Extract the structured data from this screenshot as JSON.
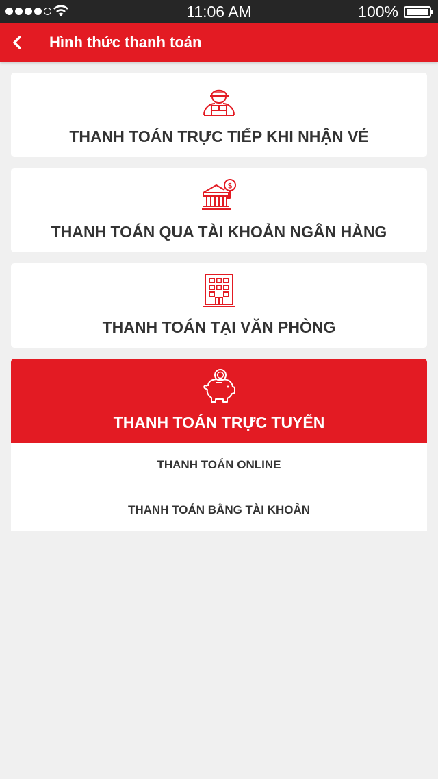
{
  "status_bar": {
    "time": "11:06 AM",
    "battery": "100%"
  },
  "header": {
    "title": "Hình thức thanh toán"
  },
  "colors": {
    "accent": "#e31b23",
    "background": "#f0f0f0",
    "card": "#ffffff",
    "text": "#333333"
  },
  "payment_options": [
    {
      "label": "THANH TOÁN TRỰC TIẾP KHI NHẬN VÉ",
      "icon": "delivery-person-icon",
      "selected": false
    },
    {
      "label": "THANH TOÁN QUA TÀI KHOẢN NGÂN HÀNG",
      "icon": "bank-icon",
      "selected": false
    },
    {
      "label": "THANH TOÁN TẠI VĂN PHÒNG",
      "icon": "office-building-icon",
      "selected": false
    },
    {
      "label": "THANH TOÁN TRỰC TUYẾN",
      "icon": "piggy-bank-icon",
      "selected": true
    }
  ],
  "online_submenu": [
    {
      "label": "THANH TOÁN ONLINE"
    },
    {
      "label": "THANH TOÁN BẰNG TÀI KHOẢN"
    }
  ]
}
